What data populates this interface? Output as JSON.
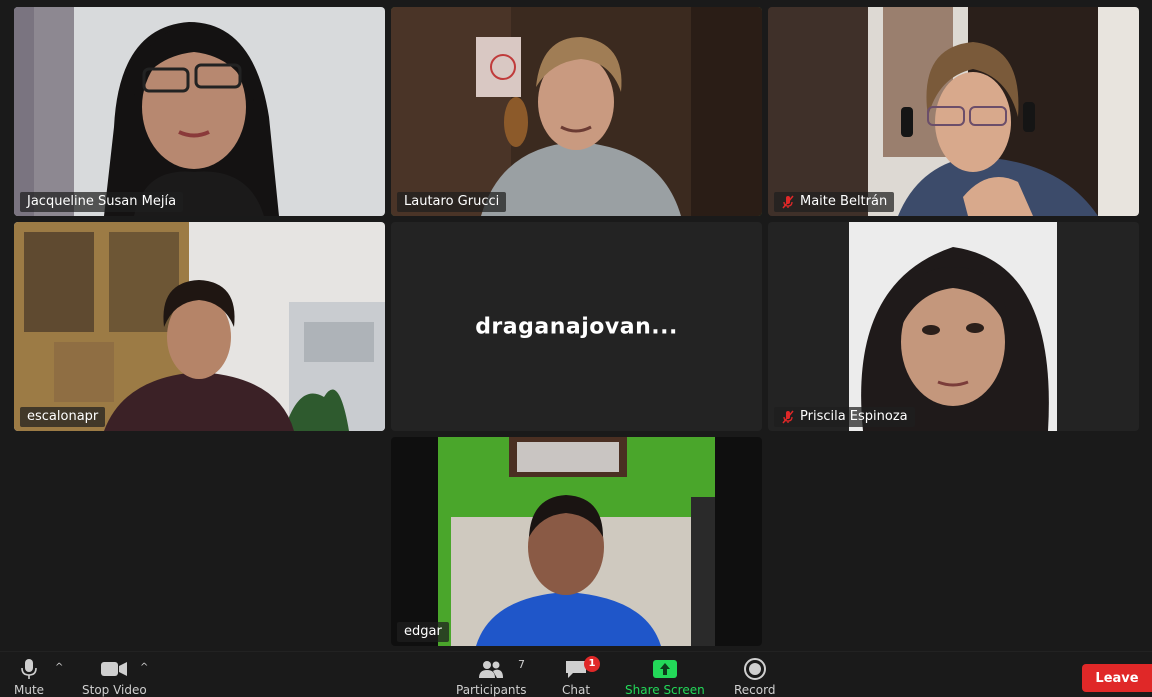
{
  "participants": [
    {
      "name": "Jacqueline Susan Mejía",
      "muted": false,
      "active": false
    },
    {
      "name": "Lautaro Grucci",
      "muted": false,
      "active": true
    },
    {
      "name": "Maite Beltrán",
      "muted": true,
      "active": false
    },
    {
      "name": "escalonapr",
      "muted": false,
      "active": false
    },
    {
      "name": "draganajovan...",
      "muted": false,
      "active": false,
      "video_off": true
    },
    {
      "name": "Priscila Espinoza",
      "muted": true,
      "active": false
    },
    {
      "name": "edgar",
      "muted": false,
      "active": false
    }
  ],
  "toolbar": {
    "mute_label": "Mute",
    "stop_video_label": "Stop Video",
    "participants_label": "Participants",
    "participants_count": "7",
    "chat_label": "Chat",
    "chat_badge": "1",
    "share_label": "Share Screen",
    "record_label": "Record",
    "leave_label": "Leave"
  },
  "colors": {
    "active_speaker": "#3fd15b",
    "share": "#23d959",
    "leave": "#e02828",
    "muted": "#e02828"
  }
}
